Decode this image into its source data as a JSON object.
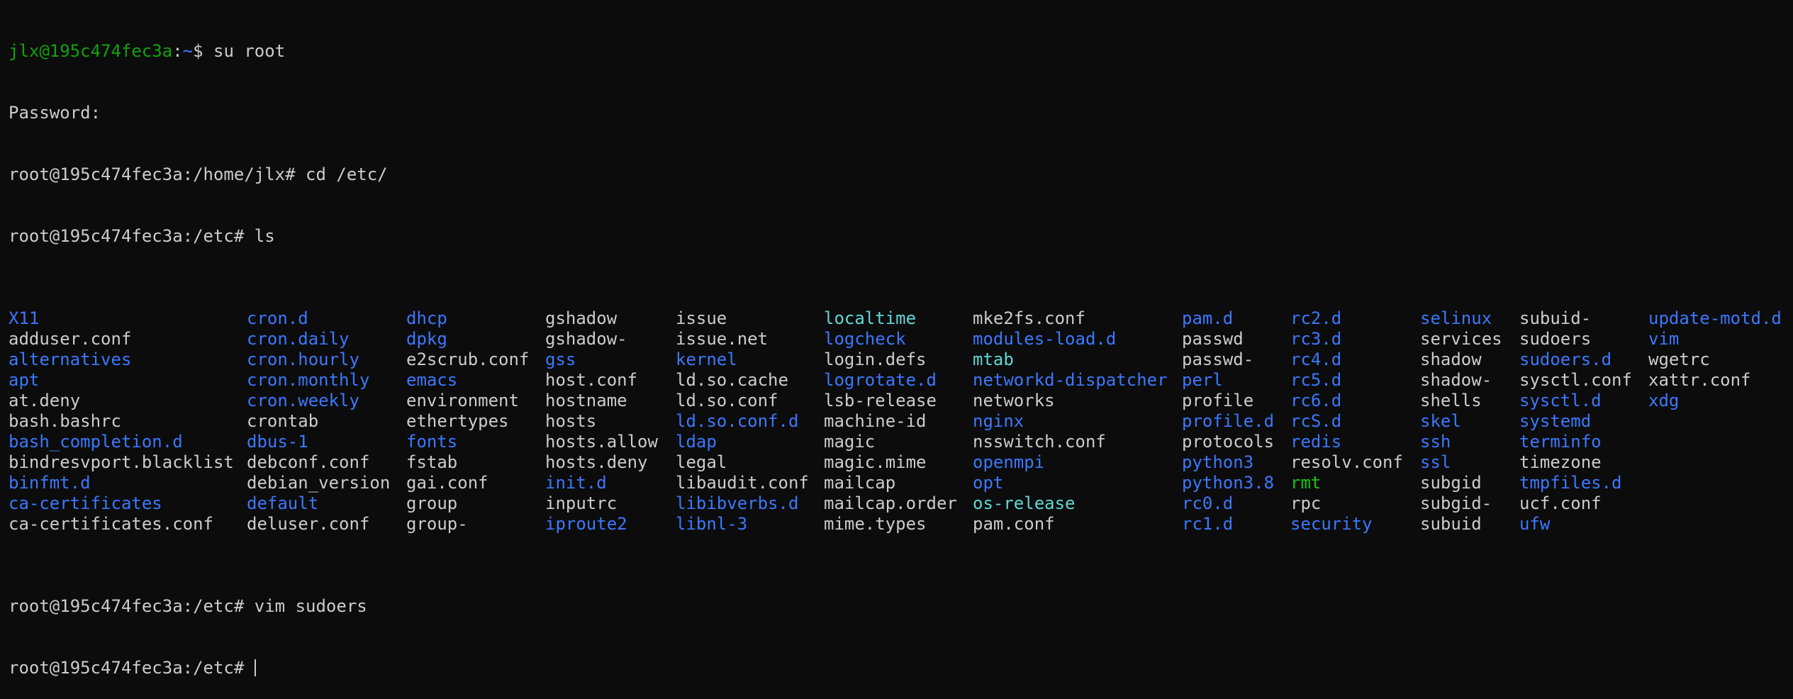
{
  "terminal": {
    "lines": [
      {
        "user_host": "jlx@195c474fec3a",
        "sep": ":",
        "path": "~",
        "suffix": "$ ",
        "command": "su root"
      },
      {
        "text": "Password:"
      },
      {
        "text": "root@195c474fec3a:/home/jlx# cd /etc/"
      },
      {
        "text": "root@195c474fec3a:/etc# ls"
      }
    ],
    "ls_output": [
      [
        "X11",
        "adduser.conf",
        "alternatives",
        "apt",
        "at.deny",
        "bash.bashrc",
        "bash_completion.d",
        "bindresvport.blacklist",
        "binfmt.d",
        "ca-certificates",
        "ca-certificates.conf"
      ],
      [
        "cron.d",
        "cron.daily",
        "cron.hourly",
        "cron.monthly",
        "cron.weekly",
        "crontab",
        "dbus-1",
        "debconf.conf",
        "debian_version",
        "default",
        "deluser.conf"
      ],
      [
        "dhcp",
        "dpkg",
        "e2scrub.conf",
        "emacs",
        "environment",
        "ethertypes",
        "fonts",
        "fstab",
        "gai.conf",
        "group",
        "group-"
      ],
      [
        "gshadow",
        "gshadow-",
        "gss",
        "host.conf",
        "hostname",
        "hosts",
        "hosts.allow",
        "hosts.deny",
        "init.d",
        "inputrc",
        "iproute2"
      ],
      [
        "issue",
        "issue.net",
        "kernel",
        "ld.so.cache",
        "ld.so.conf",
        "ld.so.conf.d",
        "ldap",
        "legal",
        "libaudit.conf",
        "libibverbs.d",
        "libnl-3"
      ],
      [
        "localtime",
        "logcheck",
        "login.defs",
        "logrotate.d",
        "lsb-release",
        "machine-id",
        "magic",
        "magic.mime",
        "mailcap",
        "mailcap.order",
        "mime.types"
      ],
      [
        "mke2fs.conf",
        "modules-load.d",
        "mtab",
        "networkd-dispatcher",
        "networks",
        "nginx",
        "nsswitch.conf",
        "openmpi",
        "opt",
        "os-release",
        "pam.conf"
      ],
      [
        "pam.d",
        "passwd",
        "passwd-",
        "perl",
        "profile",
        "profile.d",
        "protocols",
        "python3",
        "python3.8",
        "rc0.d",
        "rc1.d"
      ],
      [
        "rc2.d",
        "rc3.d",
        "rc4.d",
        "rc5.d",
        "rc6.d",
        "rcS.d",
        "redis",
        "resolv.conf",
        "rmt",
        "rpc",
        "security"
      ],
      [
        "selinux",
        "services",
        "shadow",
        "shadow-",
        "shells",
        "skel",
        "ssh",
        "ssl",
        "subgid",
        "subgid-",
        "subuid"
      ],
      [
        "subuid-",
        "sudoers",
        "sudoers.d",
        "sysctl.conf",
        "sysctl.d",
        "systemd",
        "terminfo",
        "timezone",
        "tmpfiles.d",
        "ucf.conf",
        "ufw"
      ],
      [
        "update-motd.d",
        "vim",
        "wgetrc",
        "xattr.conf",
        "xdg"
      ]
    ],
    "ls_types": [
      [
        "dir",
        "file",
        "dir",
        "dir",
        "file",
        "file",
        "dir",
        "file",
        "dir",
        "dir",
        "file"
      ],
      [
        "dir",
        "dir",
        "dir",
        "dir",
        "dir",
        "file",
        "dir",
        "file",
        "file",
        "dir",
        "file"
      ],
      [
        "dir",
        "dir",
        "file",
        "dir",
        "file",
        "file",
        "dir",
        "file",
        "file",
        "file",
        "file"
      ],
      [
        "file",
        "file",
        "dir",
        "file",
        "file",
        "file",
        "file",
        "file",
        "dir",
        "file",
        "dir"
      ],
      [
        "file",
        "file",
        "dir",
        "file",
        "file",
        "dir",
        "dir",
        "file",
        "file",
        "dir",
        "dir"
      ],
      [
        "link",
        "dir",
        "file",
        "dir",
        "file",
        "file",
        "file",
        "file",
        "file",
        "file",
        "file"
      ],
      [
        "file",
        "dir",
        "link",
        "dir",
        "file",
        "dir",
        "file",
        "dir",
        "dir",
        "link",
        "file"
      ],
      [
        "dir",
        "file",
        "file",
        "dir",
        "file",
        "dir",
        "file",
        "dir",
        "dir",
        "dir",
        "dir"
      ],
      [
        "dir",
        "dir",
        "dir",
        "dir",
        "dir",
        "dir",
        "dir",
        "file",
        "bin",
        "file",
        "dir"
      ],
      [
        "dir",
        "file",
        "file",
        "file",
        "file",
        "dir",
        "dir",
        "dir",
        "file",
        "file",
        "file"
      ],
      [
        "file",
        "file",
        "dir",
        "file",
        "dir",
        "dir",
        "dir",
        "file",
        "dir",
        "file",
        "dir"
      ],
      [
        "dir",
        "dir",
        "file",
        "file",
        "dir"
      ]
    ],
    "after_lines": [
      {
        "text": "root@195c474fec3a:/etc# vim sudoers"
      },
      {
        "text": "root@195c474fec3a:/etc# "
      }
    ],
    "colors": {
      "background": "#0c0c0c",
      "foreground": "#cccccc",
      "user_host": "#13a10e",
      "path": "#3b78ff",
      "directory": "#3b78ff",
      "symlink": "#61d6d6",
      "executable": "#16c60c"
    }
  }
}
